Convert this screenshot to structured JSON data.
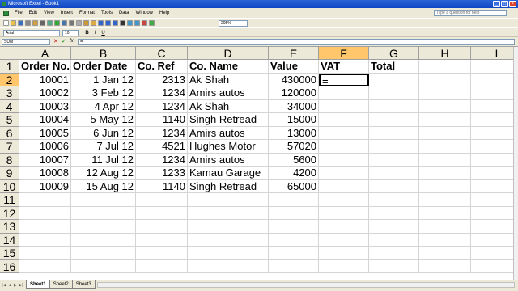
{
  "window": {
    "title": "Microsoft Excel - Book1"
  },
  "menu": [
    "File",
    "Edit",
    "View",
    "Insert",
    "Format",
    "Tools",
    "Data",
    "Window",
    "Help"
  ],
  "help_placeholder": "Type a question for help",
  "toolbar": {
    "zoom": "205%",
    "font": "Arial",
    "size": "10",
    "bold": "B",
    "italic": "I",
    "underline": "U"
  },
  "formula_bar": {
    "name_box": "SUM",
    "fx": "fx",
    "formula": "="
  },
  "columns": [
    "A",
    "B",
    "C",
    "D",
    "E",
    "F",
    "G",
    "H",
    "I"
  ],
  "rows": [
    "1",
    "2",
    "3",
    "4",
    "5",
    "6",
    "7",
    "8",
    "9",
    "10",
    "11",
    "12",
    "13",
    "14",
    "15",
    "16"
  ],
  "headers": [
    "Order No.",
    "Order Date",
    "Co. Ref",
    "Co. Name",
    "Value",
    "VAT",
    "Total"
  ],
  "data": [
    [
      "10001",
      "1 Jan 12",
      "2313",
      "Ak Shah",
      "430000"
    ],
    [
      "10002",
      "3 Feb 12",
      "1234",
      "Amirs autos",
      "120000"
    ],
    [
      "10003",
      "4 Apr 12",
      "1234",
      "Ak Shah",
      "34000"
    ],
    [
      "10004",
      "5 May 12",
      "1140",
      "Singh Retread",
      "15000"
    ],
    [
      "10005",
      "6 Jun 12",
      "1234",
      "Amirs autos",
      "13000"
    ],
    [
      "10006",
      "7 Jul 12",
      "4521",
      "Hughes Motor",
      "57020"
    ],
    [
      "10007",
      "11 Jul 12",
      "1234",
      "Amirs autos",
      "5600"
    ],
    [
      "10008",
      "12 Aug 12",
      "1233",
      "Kamau Garage",
      "4200"
    ],
    [
      "10009",
      "15 Aug 12",
      "1140",
      "Singh Retread",
      "65000"
    ]
  ],
  "active_cell_value": "=",
  "sheets": [
    "Sheet1",
    "Sheet2",
    "Sheet3"
  ]
}
